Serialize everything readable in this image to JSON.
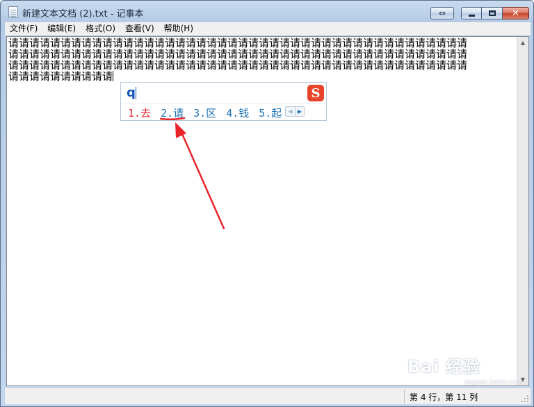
{
  "window": {
    "title": "新建文本文档 (2).txt - 记事本",
    "icons": {
      "app": "notepad-icon",
      "restore_extra": "double-arrow-icon",
      "minimize": "minimize-icon",
      "maximize": "maximize-icon",
      "close": "close-icon"
    },
    "glyphs": {
      "restore_extra": "⇔",
      "close": "✕"
    }
  },
  "menubar": {
    "items": [
      {
        "label": "文件(F)"
      },
      {
        "label": "编辑(E)"
      },
      {
        "label": "格式(O)"
      },
      {
        "label": "查看(V)"
      },
      {
        "label": "帮助(H)"
      }
    ]
  },
  "editor": {
    "lines": [
      "请请请请请请请请请请请请请请请请请请请请请请请请请请请请请请请请请请请请请请请请请请请请",
      "请请请请请请请请请请请请请请请请请请请请请请请请请请请请请请请请请请请请请请请请请请请请",
      "请请请请请请请请请请请请请请请请请请请请请请请请请请请请请请请请请请请请请请请请请请请请",
      "请请请请请请请请请请"
    ]
  },
  "ime": {
    "input_code": "q",
    "logo": "S",
    "candidates": [
      {
        "label": "1.去"
      },
      {
        "label": "2.请"
      },
      {
        "label": "3.区"
      },
      {
        "label": "4.钱"
      },
      {
        "label": "5.起"
      }
    ],
    "pager": {
      "prev": "◀",
      "next": "▶"
    },
    "colors": {
      "selected": "#e2232e",
      "normal": "#1e73b6",
      "annotation": "#e8232a"
    }
  },
  "statusbar": {
    "position": "第 4 行，第 11 列"
  },
  "scrollbar": {
    "up": "▲",
    "down": "▼"
  },
  "watermark": {
    "text": "Bai 经验",
    "subtext": "jingyan.baidu.com"
  }
}
